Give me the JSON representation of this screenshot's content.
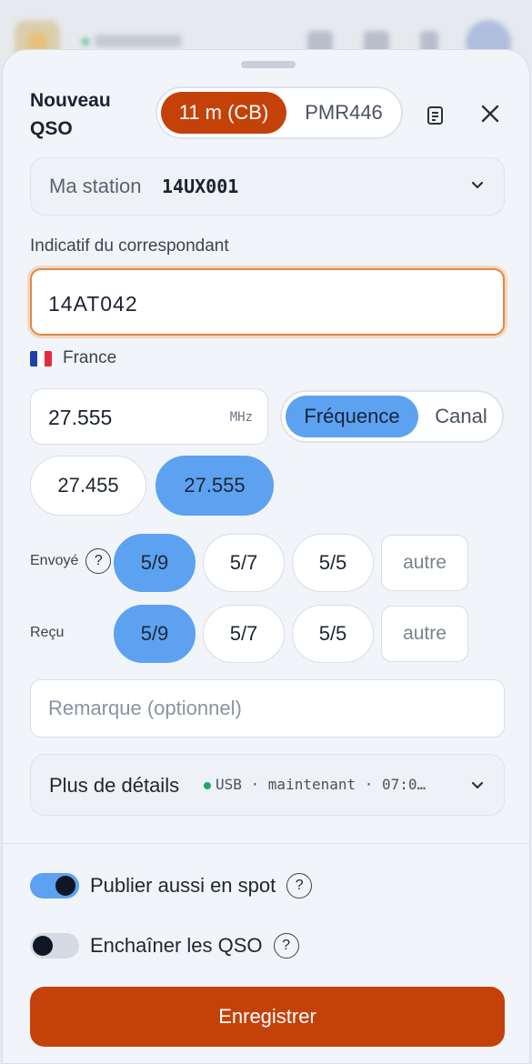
{
  "header": {
    "title": "Nouveau QSO"
  },
  "band_switch": {
    "options": [
      "11 m (CB)",
      "PMR446"
    ],
    "selected": "11 m (CB)"
  },
  "station": {
    "label": "Ma station",
    "callsign": "14UX001"
  },
  "correspondent": {
    "label": "Indicatif du correspondant",
    "value": "14AT042",
    "country": "France",
    "country_flag_colors": [
      "#1e3fae",
      "#ffffff",
      "#e22b3c"
    ]
  },
  "frequency": {
    "value": "27.555",
    "unit": "MHz",
    "mode_options": [
      "Fréquence",
      "Canal"
    ],
    "selected_mode": "Fréquence",
    "recent": [
      "27.455",
      "27.555"
    ],
    "selected_recent": "27.555"
  },
  "report_sent": {
    "label": "Envoyé",
    "help": "?",
    "options": [
      "5/9",
      "5/7",
      "5/5"
    ],
    "selected": "5/9",
    "other": "autre"
  },
  "report_received": {
    "label": "Reçu",
    "options": [
      "5/9",
      "5/7",
      "5/5"
    ],
    "selected": "5/9",
    "other": "autre"
  },
  "remark": {
    "placeholder": "Remarque (optionnel)"
  },
  "details": {
    "label": "Plus de détails",
    "summary": "USB · maintenant · 07:0…"
  },
  "options": {
    "spot": {
      "label": "Publier aussi en spot",
      "help": "?",
      "on": true
    },
    "chain": {
      "label": "Enchaîner les QSO",
      "help": "?",
      "on": false
    }
  },
  "save_button": {
    "label": "Enregistrer"
  },
  "colors": {
    "accent": "#c4420a",
    "selection": "#5da2f0"
  }
}
